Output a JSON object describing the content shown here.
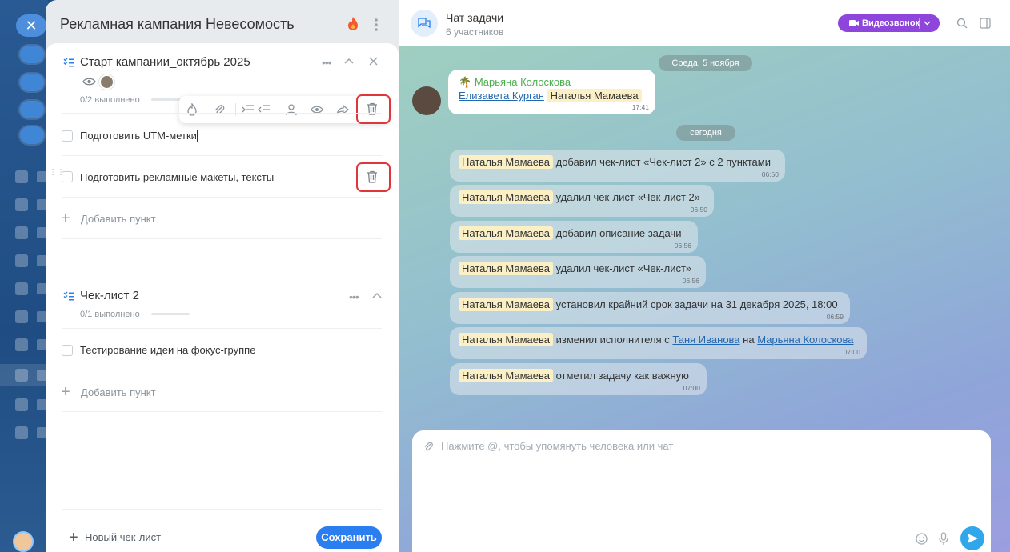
{
  "task": {
    "title": "Рекламная кампания Невесомость",
    "checklists": [
      {
        "title": "Старт кампании_октябрь 2025",
        "progress": "0/2 выполнено",
        "items": [
          "Подготовить UTM-метки",
          "Подготовить рекламные макеты, тексты"
        ],
        "add_label": "Добавить пункт"
      },
      {
        "title": "Чек-лист 2",
        "progress": "0/1 выполнено",
        "items": [
          "Тестирование идеи на фокус-группе"
        ],
        "add_label": "Добавить пункт"
      }
    ],
    "new_checklist_label": "Новый чек-лист",
    "save_label": "Сохранить"
  },
  "chat": {
    "title": "Чат задачи",
    "subtitle": "6 участников",
    "video_label": "Видеозвонок",
    "date1": "Среда, 5 ноября",
    "date2": "сегодня",
    "first_message": {
      "author": "Марьяна Колоскова",
      "mention1": "Елизавета Курган",
      "mention2": "Наталья Мамаева",
      "time": "17:41"
    },
    "messages": [
      {
        "user": "Наталья Мамаева",
        "text": "добавил чек-лист «Чек-лист 2» с 2 пунктами",
        "time": "06:50"
      },
      {
        "user": "Наталья Мамаева",
        "text": "удалил чек-лист «Чек-лист 2»",
        "time": "06:50"
      },
      {
        "user": "Наталья Мамаева",
        "text": "добавил описание задачи",
        "time": "06:56"
      },
      {
        "user": "Наталья Мамаева",
        "text": "удалил чек-лист «Чек-лист»",
        "time": "06:56"
      },
      {
        "user": "Наталья Мамаева",
        "text": "установил крайний срок задачи на 31 декабря 2025, 18:00",
        "time": "06:59"
      },
      {
        "user": "Наталья Мамаева",
        "text": "изменил исполнителя с",
        "link1": "Таня Иванова",
        "mid": "на",
        "link2": "Марьяна Колоскова",
        "time": "07:00"
      },
      {
        "user": "Наталья Мамаева",
        "text": "отметил задачу как важную",
        "time": "07:00"
      }
    ],
    "input_placeholder": "Нажмите @, чтобы упомянуть человека или чат"
  },
  "colors": {
    "accent_blue": "#2a7ef0",
    "video_purple": "#8e45dc",
    "highlight_red": "#e0363b",
    "author_green": "#4caf50"
  }
}
